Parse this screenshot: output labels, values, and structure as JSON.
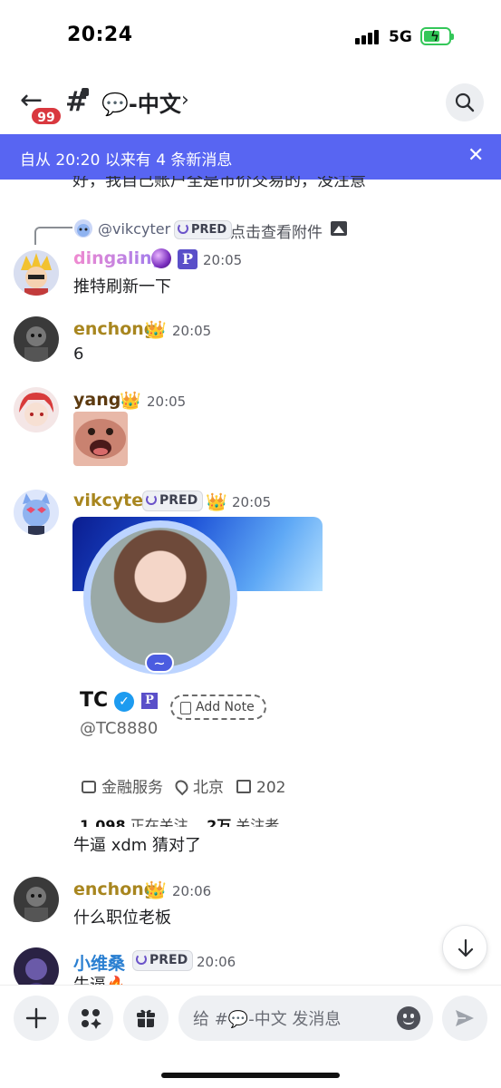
{
  "status_bar": {
    "time": "20:24",
    "network": "5G",
    "battery_charging": true
  },
  "header": {
    "back_badge": "99",
    "channel_emoji": "💬",
    "channel_name": "💬-中文"
  },
  "new_messages_bar": {
    "text": "自从 20:20 以来有 4 条新消息"
  },
  "partial_message": "好，我自己账户全是市价交易的，没注意",
  "reply": {
    "user": "@vikcyter",
    "tag": "PRED",
    "text": "点击查看附件"
  },
  "messages": [
    {
      "user": "dingaling",
      "time": "20:05",
      "text": "推特刷新一下",
      "color": "#d87ae0"
    },
    {
      "user": "enchong",
      "time": "20:05",
      "text": "6",
      "color": "#a8861f"
    },
    {
      "user": "yang",
      "time": "20:05",
      "text": "",
      "color": "#5c3a10"
    },
    {
      "user": "vikcyter",
      "time": "20:05",
      "tag": "PRED",
      "text": "牛逼 xdm 猜对了",
      "color": "#a8861f"
    },
    {
      "user": "enchong",
      "time": "20:06",
      "text": "什么职位老板",
      "color": "#a8861f"
    },
    {
      "user": "小维桑",
      "time": "20:06",
      "tag": "PRED",
      "text": "牛逼🔥",
      "color": "#2a7fd1"
    }
  ],
  "embed": {
    "name": "TC",
    "handle": "@TC8880",
    "add_note": "Add Note",
    "industry": "金融服务",
    "location": "北京",
    "joined": "202",
    "following_count": "1,098",
    "following_label": "正在关注",
    "followers_count": "2万",
    "followers_label": "关注者",
    "avatar_tilde": "~"
  },
  "composer": {
    "placeholder": "给 #💬-中文 发消息"
  },
  "colors": {
    "accent": "#5865f2",
    "badge_red": "#d9383f"
  }
}
